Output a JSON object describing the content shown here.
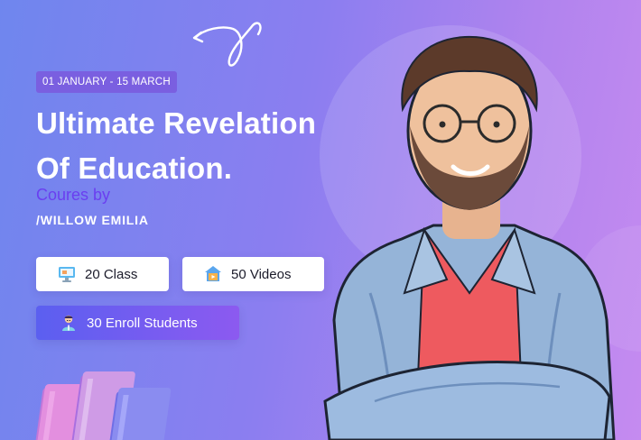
{
  "banner": {
    "date_range": "01 JANUARY - 15 MARCH",
    "headline_line1": "Ultimate Revelation",
    "headline_line2": "Of Education.",
    "courses_by": "Coures by",
    "author": "/WILLOW EMILIA",
    "stats": {
      "classes": "20 Class",
      "videos": "50 Videos",
      "enroll": "30 Enroll Students"
    },
    "icons": {
      "classes": "monitor-icon",
      "videos": "video-house-icon",
      "enroll": "student-icon",
      "swirl": "curved-arrow-icon",
      "books": "books-illustration",
      "person": "instructor-photo"
    },
    "colors": {
      "bg_start": "#6f86ee",
      "bg_end": "#c58bf0",
      "date_badge": "#7a5fe0",
      "courses_by": "#6a3ff0",
      "enroll_start": "#5b5ff0",
      "enroll_end": "#8c5af0"
    }
  }
}
